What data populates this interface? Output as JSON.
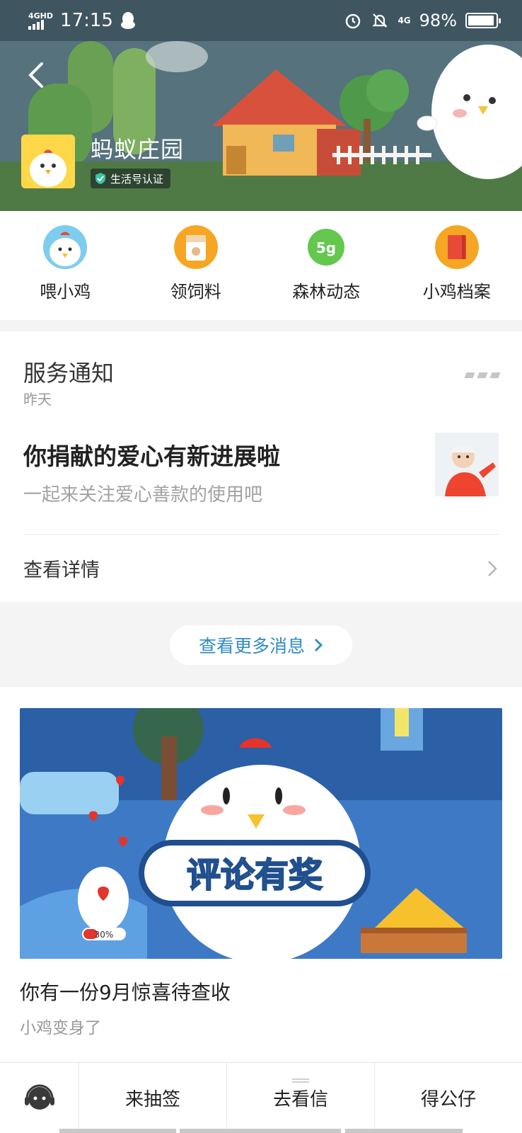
{
  "status_bar": {
    "network": "4GHD",
    "time": "17:15",
    "network_right": "4G",
    "battery": "98%"
  },
  "header": {
    "app_name": "蚂蚁庄园",
    "verified_badge": "生活号认证"
  },
  "actions": [
    {
      "label": "喂小鸡",
      "icon": "chick-face-icon"
    },
    {
      "label": "领饲料",
      "icon": "feed-bag-icon"
    },
    {
      "label": "森林动态",
      "icon": "energy-5g-icon"
    },
    {
      "label": "小鸡档案",
      "icon": "archive-book-icon"
    }
  ],
  "energy_icon_text": "5g",
  "notice": {
    "title": "服务通知",
    "time": "昨天",
    "headline": "你捐献的爱心有新进展啦",
    "description": "一起来关注爱心善款的使用吧",
    "detail_label": "查看详情"
  },
  "more_messages": "查看更多消息",
  "promo": {
    "banner_text": "评论有奖",
    "egg_progress": "30%",
    "title": "你有一份9月惊喜待查收",
    "subtitle": "小鸡变身了"
  },
  "bottom_nav": {
    "items": [
      "来抽签",
      "去看信",
      "得公仔"
    ]
  },
  "colors": {
    "status_bar": "#3f5661",
    "accent_blue": "#2f8bc6",
    "promo_bg": "#3e79c6"
  }
}
